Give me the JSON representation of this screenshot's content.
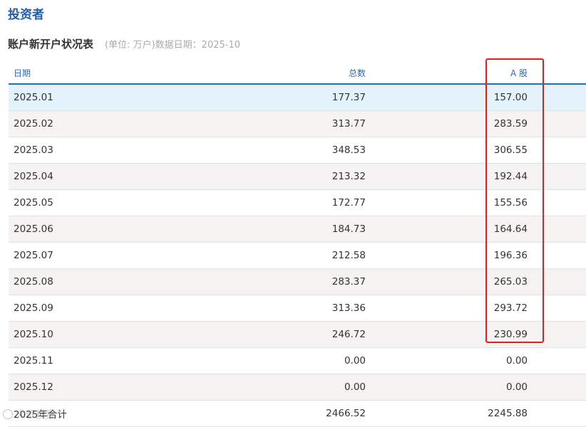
{
  "page": {
    "title": "投资者"
  },
  "table": {
    "title": "账户新开户状况表",
    "note": "(单位: 万户)数据日期：2025-10",
    "headers": {
      "date": "日期",
      "total": "总数",
      "a_share": "A 股"
    },
    "rows": [
      {
        "date": "2025.01",
        "total": "177.37",
        "a_share": "157.00"
      },
      {
        "date": "2025.02",
        "total": "313.77",
        "a_share": "283.59"
      },
      {
        "date": "2025.03",
        "total": "348.53",
        "a_share": "306.55"
      },
      {
        "date": "2025.04",
        "total": "213.32",
        "a_share": "192.44"
      },
      {
        "date": "2025.05",
        "total": "172.77",
        "a_share": "155.56"
      },
      {
        "date": "2025.06",
        "total": "184.73",
        "a_share": "164.64"
      },
      {
        "date": "2025.07",
        "total": "212.58",
        "a_share": "196.36"
      },
      {
        "date": "2025.08",
        "total": "283.37",
        "a_share": "265.03"
      },
      {
        "date": "2025.09",
        "total": "313.36",
        "a_share": "293.72"
      },
      {
        "date": "2025.10",
        "total": "246.72",
        "a_share": "230.99"
      },
      {
        "date": "2025.11",
        "total": "0.00",
        "a_share": "0.00"
      },
      {
        "date": "2025.12",
        "total": "0.00",
        "a_share": "0.00"
      },
      {
        "date": "2025年合计",
        "total": "2466.52",
        "a_share": "2245.88"
      }
    ]
  },
  "watermark": {
    "text": "大叔投资"
  },
  "colors": {
    "title": "#1f5ea8",
    "header": "#2b6cb0",
    "row_alt": "#f4f3f1",
    "row_highlight": "#e4f2fc",
    "annotation_box": "#e02020"
  }
}
